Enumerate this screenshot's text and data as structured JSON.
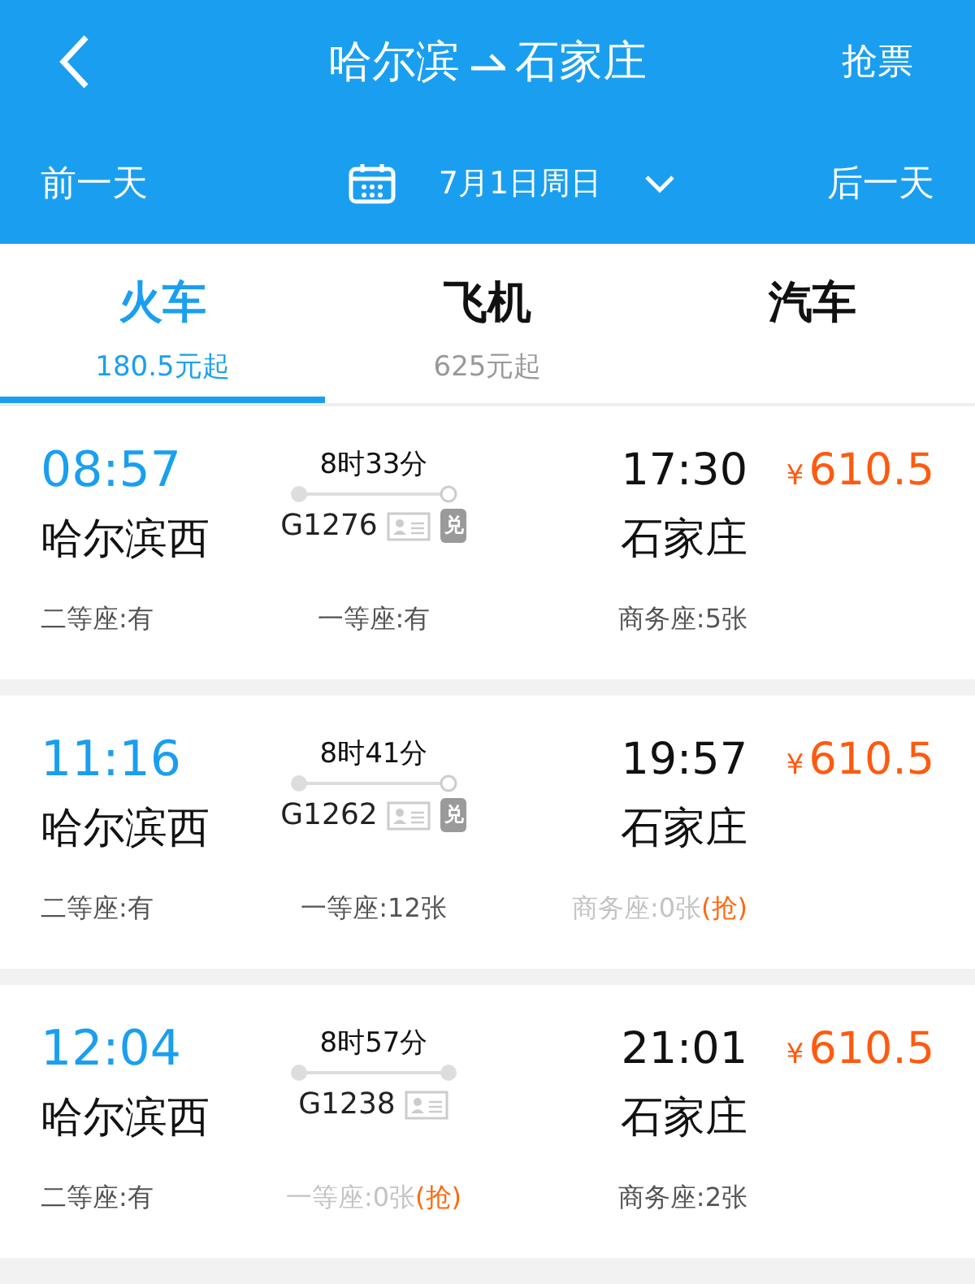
{
  "header": {
    "from": "哈尔滨",
    "to": "石家庄",
    "action": "抢票"
  },
  "date_bar": {
    "prev": "前一天",
    "date": "7月1日周日",
    "next": "后一天"
  },
  "tabs": [
    {
      "label": "火车",
      "price": "180.5元起",
      "selected": true
    },
    {
      "label": "飞机",
      "price": "625元起",
      "selected": false
    },
    {
      "label": "汽车",
      "selected": false
    }
  ],
  "trains": [
    {
      "depart_time": "08:57",
      "depart_station": "哈尔滨西",
      "duration": "8时33分",
      "number": "G1276",
      "exchange_badge": "兑",
      "end_dot_hollow": true,
      "arrive_time": "17:30",
      "arrive_station": "石家庄",
      "currency": "¥",
      "price": "610.5",
      "seats": [
        {
          "label": "二等座:有",
          "available": true
        },
        {
          "label": "一等座:有",
          "available": true
        },
        {
          "label": "商务座:5张",
          "available": true
        }
      ]
    },
    {
      "depart_time": "11:16",
      "depart_station": "哈尔滨西",
      "duration": "8时41分",
      "number": "G1262",
      "exchange_badge": "兑",
      "end_dot_hollow": true,
      "arrive_time": "19:57",
      "arrive_station": "石家庄",
      "currency": "¥",
      "price": "610.5",
      "seats": [
        {
          "label": "二等座:有",
          "available": true
        },
        {
          "label": "一等座:12张",
          "available": true
        },
        {
          "label": "商务座:0张",
          "available": false,
          "grab": "(抢)"
        }
      ]
    },
    {
      "depart_time": "12:04",
      "depart_station": "哈尔滨西",
      "duration": "8时57分",
      "number": "G1238",
      "end_dot_hollow": false,
      "arrive_time": "21:01",
      "arrive_station": "石家庄",
      "currency": "¥",
      "price": "610.5",
      "seats": [
        {
          "label": "二等座:有",
          "available": true
        },
        {
          "label": "一等座:0张",
          "available": false,
          "grab": "(抢)"
        },
        {
          "label": "商务座:2张",
          "available": true
        }
      ]
    }
  ]
}
